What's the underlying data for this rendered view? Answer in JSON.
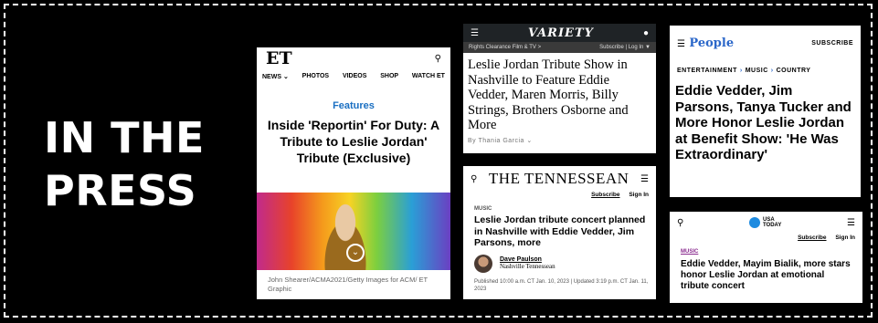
{
  "headline": {
    "line1": "IN THE",
    "line2": "PRESS"
  },
  "et": {
    "logo": "ET",
    "nav": [
      "NEWS ⌄",
      "PHOTOS",
      "VIDEOS",
      "SHOP",
      "WATCH ET"
    ],
    "kicker": "Features",
    "title": "Inside 'Reportin' For Duty: A Tribute to Leslie Jordan' Tribute (Exclusive)",
    "caption": "John Shearer/ACMA2021/Getty Images for ACM/ ET Graphic"
  },
  "variety": {
    "logo": "VARIETY",
    "subleft": "Rights Clearance Film & TV >",
    "subright": "Subscribe | Log In ▼",
    "title": "Leslie Jordan Tribute Show in Nashville to Feature Eddie Vedder, Maren Morris, Billy Strings, Brothers Osborne and More",
    "byline": "By Thania Garcia ⌄"
  },
  "tennessean": {
    "logo": "THE TENNESSEAN",
    "subscribe": "Subscribe",
    "signin": "Sign In",
    "section": "MUSIC",
    "title": "Leslie Jordan tribute concert planned in Nashville with Eddie Vedder, Jim Parsons, more",
    "author": "Dave Paulson",
    "org": "Nashville Tennessean",
    "published": "Published 10:00 a.m. CT Jan. 10, 2023 | Updated 3:19 p.m. CT Jan. 11, 2023"
  },
  "people": {
    "logo": "People",
    "subscribe": "SUBSCRIBE",
    "crumbs": [
      "ENTERTAINMENT",
      "MUSIC",
      "COUNTRY"
    ],
    "title": "Eddie Vedder, Jim Parsons, Tanya Tucker and More Honor Leslie Jordan at Benefit Show: 'He Was Extraordinary'"
  },
  "usatoday": {
    "logo1": "USA",
    "logo2": "TODAY",
    "subscribe": "Subscribe",
    "signin": "Sign In",
    "section": "MUSIC",
    "title": "Eddie Vedder, Mayim Bialik, more stars honor Leslie Jordan at emotional tribute concert"
  }
}
